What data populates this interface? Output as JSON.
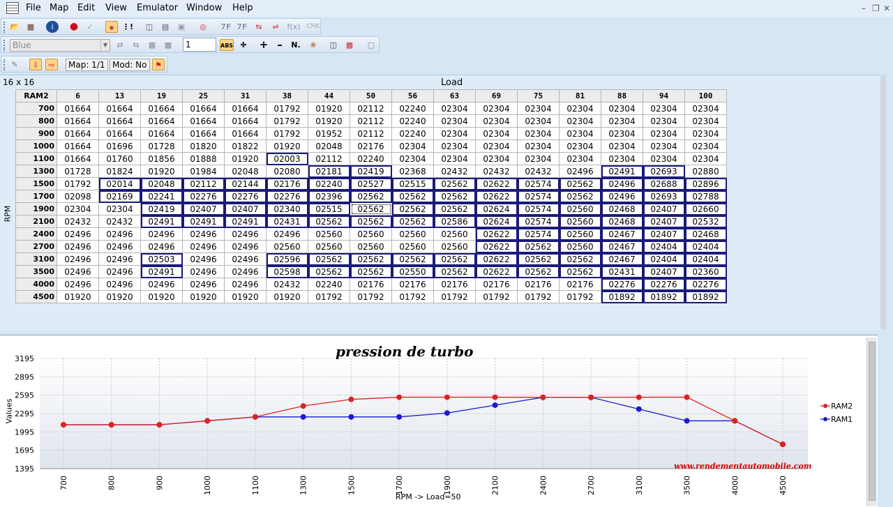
{
  "menu": {
    "file": "File",
    "map": "Map",
    "edit": "Edit",
    "view": "View",
    "emulator": "Emulator",
    "window": "Window",
    "help": "Help"
  },
  "toolbar1": {
    "icons": [
      "open-icon",
      "save-icon",
      "info-icon",
      "record-icon",
      "connect-icon",
      "checksum-icon",
      "diff-icon",
      "copy-map-icon",
      "paste-map-icon",
      "compare-icon",
      "target-icon",
      "hex-7f-icon",
      "and-7f-icon",
      "swap-icon",
      "toggle-icon",
      "function-icon"
    ],
    "labels": {
      "fx": "f(x)",
      "chk": "CHK",
      "h7f": "7F",
      "a7f": "7F"
    }
  },
  "toolbar2": {
    "color_select": "Blue",
    "step_value": "1",
    "n_label": "N.",
    "abs_label": "ABS"
  },
  "toolbar3": {
    "map_status": "Map: 1/1",
    "mod_status": "Mod: No"
  },
  "map": {
    "dimensions": "16 x 16",
    "x_axis_label": "Load",
    "y_axis_label": "RPM",
    "corner": "RAM2",
    "columns": [
      "6",
      "13",
      "19",
      "25",
      "31",
      "38",
      "44",
      "50",
      "56",
      "63",
      "69",
      "75",
      "81",
      "88",
      "94",
      "100"
    ],
    "rows": [
      {
        "rpm": "700",
        "cells": [
          "01664",
          "01664",
          "01664",
          "01664",
          "01664",
          "01792",
          "01920",
          "02112",
          "02240",
          "02304",
          "02304",
          "02304",
          "02304",
          "02304",
          "02304",
          "02304"
        ]
      },
      {
        "rpm": "800",
        "cells": [
          "01664",
          "01664",
          "01664",
          "01664",
          "01664",
          "01792",
          "01920",
          "02112",
          "02240",
          "02304",
          "02304",
          "02304",
          "02304",
          "02304",
          "02304",
          "02304"
        ]
      },
      {
        "rpm": "900",
        "cells": [
          "01664",
          "01664",
          "01664",
          "01664",
          "01664",
          "01792",
          "01952",
          "02112",
          "02240",
          "02304",
          "02304",
          "02304",
          "02304",
          "02304",
          "02304",
          "02304"
        ]
      },
      {
        "rpm": "1000",
        "cells": [
          "01664",
          "01696",
          "01728",
          "01820",
          "01822",
          "01920",
          "02048",
          "02176",
          "02304",
          "02304",
          "02304",
          "02304",
          "02304",
          "02304",
          "02304",
          "02304"
        ]
      },
      {
        "rpm": "1100",
        "cells": [
          "01664",
          "01760",
          "01856",
          "01888",
          "01920",
          "02003",
          "02112",
          "02240",
          "02304",
          "02304",
          "02304",
          "02304",
          "02304",
          "02304",
          "02304",
          "02304"
        ]
      },
      {
        "rpm": "1300",
        "cells": [
          "01728",
          "01824",
          "01920",
          "01984",
          "02048",
          "02080",
          "02181",
          "02419",
          "02368",
          "02432",
          "02432",
          "02432",
          "02496",
          "02491",
          "02693",
          "02880"
        ]
      },
      {
        "rpm": "1500",
        "cells": [
          "01792",
          "02014",
          "02048",
          "02112",
          "02144",
          "02176",
          "02240",
          "02527",
          "02515",
          "02562",
          "02622",
          "02574",
          "02562",
          "02496",
          "02688",
          "02896"
        ]
      },
      {
        "rpm": "1700",
        "cells": [
          "02098",
          "02169",
          "02241",
          "02276",
          "02276",
          "02276",
          "02396",
          "02562",
          "02562",
          "02562",
          "02622",
          "02574",
          "02562",
          "02496",
          "02693",
          "02788"
        ]
      },
      {
        "rpm": "1900",
        "cells": [
          "02304",
          "02304",
          "02419",
          "02407",
          "02407",
          "02340",
          "02515",
          "02562",
          "02562",
          "02562",
          "02624",
          "02574",
          "02560",
          "02468",
          "02407",
          "02660"
        ]
      },
      {
        "rpm": "2100",
        "cells": [
          "02432",
          "02432",
          "02491",
          "02491",
          "02491",
          "02431",
          "02562",
          "02562",
          "02562",
          "02586",
          "02624",
          "02574",
          "02560",
          "02468",
          "02407",
          "02532"
        ]
      },
      {
        "rpm": "2400",
        "cells": [
          "02496",
          "02496",
          "02496",
          "02496",
          "02496",
          "02496",
          "02560",
          "02560",
          "02560",
          "02560",
          "02622",
          "02574",
          "02560",
          "02467",
          "02407",
          "02468"
        ]
      },
      {
        "rpm": "2700",
        "cells": [
          "02496",
          "02496",
          "02496",
          "02496",
          "02496",
          "02560",
          "02560",
          "02560",
          "02560",
          "02560",
          "02622",
          "02562",
          "02560",
          "02467",
          "02404",
          "02404"
        ]
      },
      {
        "rpm": "3100",
        "cells": [
          "02496",
          "02496",
          "02503",
          "02496",
          "02496",
          "02596",
          "02562",
          "02562",
          "02562",
          "02562",
          "02622",
          "02562",
          "02562",
          "02467",
          "02404",
          "02404"
        ]
      },
      {
        "rpm": "3500",
        "cells": [
          "02496",
          "02496",
          "02491",
          "02496",
          "02496",
          "02598",
          "02562",
          "02562",
          "02550",
          "02562",
          "02622",
          "02562",
          "02562",
          "02431",
          "02407",
          "02360"
        ]
      },
      {
        "rpm": "4000",
        "cells": [
          "02496",
          "02496",
          "02496",
          "02496",
          "02496",
          "02432",
          "02240",
          "02176",
          "02176",
          "02176",
          "02176",
          "02176",
          "02176",
          "02276",
          "02276",
          "02276"
        ]
      },
      {
        "rpm": "4500",
        "cells": [
          "01920",
          "01920",
          "01920",
          "01920",
          "01920",
          "01920",
          "01792",
          "01792",
          "01792",
          "01792",
          "01792",
          "01792",
          "01792",
          "01892",
          "01892",
          "01892"
        ]
      }
    ]
  },
  "chart_data": {
    "type": "line",
    "title": "pression de turbo",
    "xlabel": "RPM -> Load=50",
    "ylabel": "Values",
    "categories": [
      "700",
      "800",
      "900",
      "1000",
      "1100",
      "1300",
      "1500",
      "1700",
      "1900",
      "2100",
      "2400",
      "2700",
      "3100",
      "3500",
      "4000",
      "4500"
    ],
    "yticks": [
      "3195",
      "2895",
      "2595",
      "2295",
      "1995",
      "1695",
      "1395"
    ],
    "ylim": [
      1395,
      3195
    ],
    "grid": true,
    "legend_position": "right",
    "series": [
      {
        "name": "RAM2",
        "color": "#e02020",
        "values": [
          2112,
          2112,
          2112,
          2176,
          2240,
          2419,
          2527,
          2562,
          2562,
          2562,
          2560,
          2560,
          2562,
          2562,
          2176,
          1792
        ]
      },
      {
        "name": "RAM1",
        "color": "#1a1ad0",
        "values": [
          2112,
          2112,
          2112,
          2176,
          2240,
          2240,
          2240,
          2240,
          2304,
          2432,
          2560,
          2560,
          2368,
          2176,
          2176,
          1792
        ]
      }
    ],
    "watermark": "www.rendementautomobile.com"
  }
}
